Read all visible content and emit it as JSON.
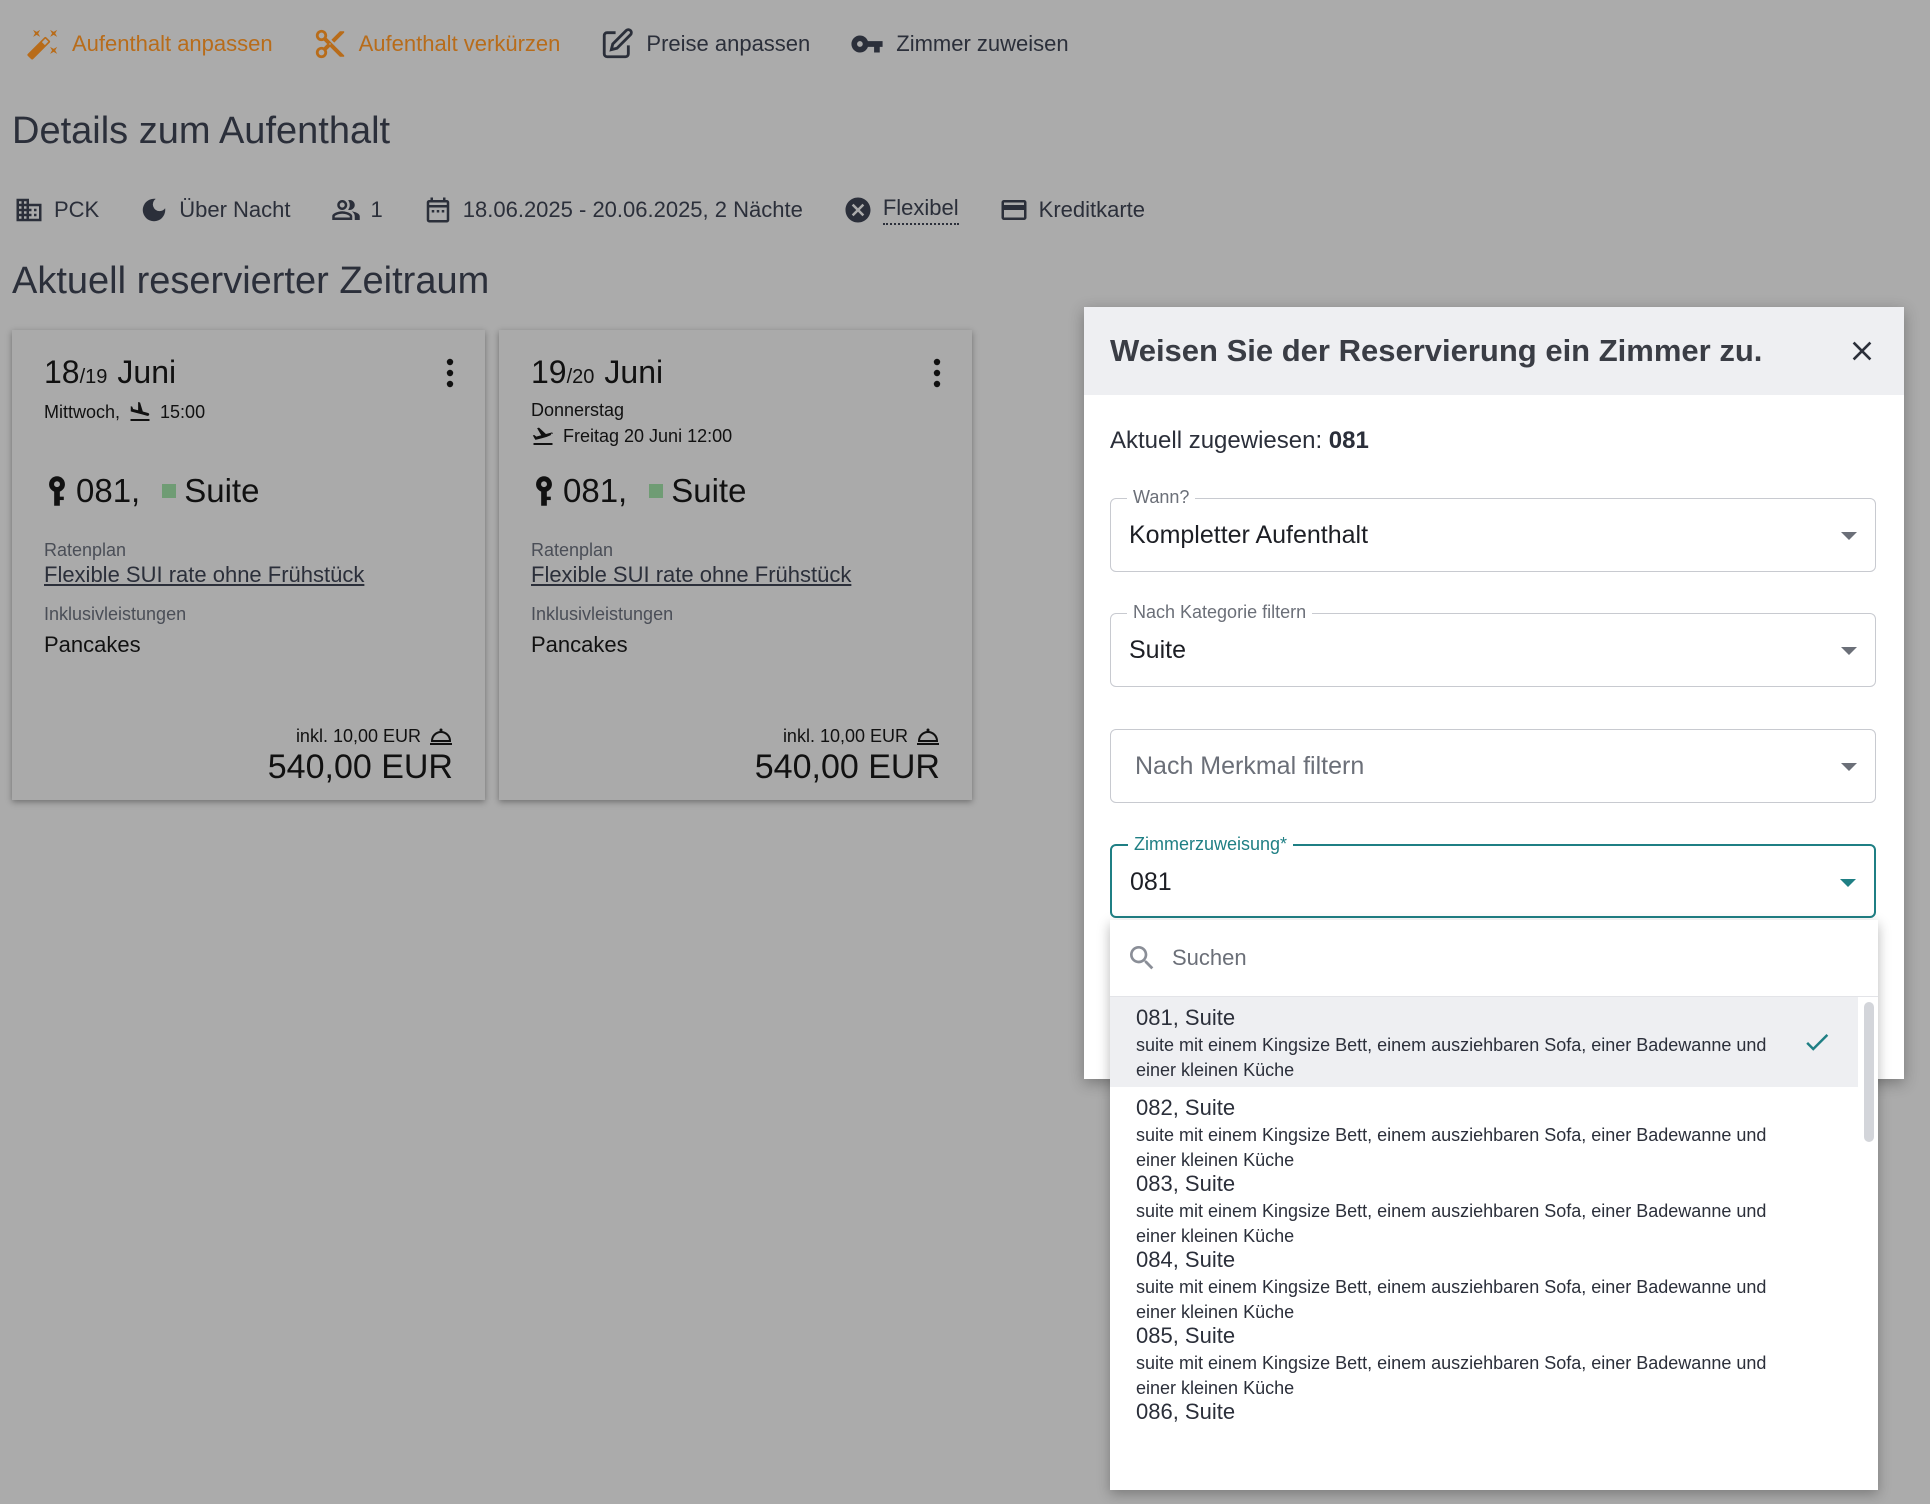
{
  "toolbar": {
    "adjust_stay": "Aufenthalt anpassen",
    "shorten_stay": "Aufenthalt verkürzen",
    "adjust_prices": "Preise anpassen",
    "assign_room": "Zimmer zuweisen"
  },
  "details": {
    "title": "Details zum Aufenthalt",
    "property": "PCK",
    "stay_type": "Über Nacht",
    "guests": "1",
    "dates": "18.06.2025 - 20.06.2025, 2 Nächte",
    "cancellation": "Flexibel",
    "payment": "Kreditkarte"
  },
  "period_title": "Aktuell reservierter Zeitraum",
  "days": [
    {
      "day": "18",
      "next": "/19",
      "month": "Juni",
      "weekday": "Mittwoch,",
      "arrival_time": "15:00",
      "room": "081,",
      "category": "Suite",
      "rate_label": "Ratenplan",
      "rate": "Flexible SUI rate ohne Frühstück",
      "incl_label": "Inklusivleistungen",
      "incl": "Pancakes",
      "fee": "inkl. 10,00 EUR",
      "price": "540,00 EUR"
    },
    {
      "day": "19",
      "next": "/20",
      "month": "Juni",
      "weekday": "Donnerstag",
      "departure": "Freitag  20 Juni 12:00",
      "room": "081,",
      "category": "Suite",
      "rate_label": "Ratenplan",
      "rate": "Flexible SUI rate ohne Frühstück",
      "incl_label": "Inklusivleistungen",
      "incl": "Pancakes",
      "fee": "inkl. 10,00 EUR",
      "price": "540,00 EUR"
    }
  ],
  "dialog": {
    "title": "Weisen Sie der Reservierung ein Zimmer zu.",
    "current_label": "Aktuell zugewiesen:",
    "current_value": "081",
    "when_label": "Wann?",
    "when_value": "Kompletter Aufenthalt",
    "category_label": "Nach Kategorie filtern",
    "category_value": "Suite",
    "feature_placeholder": "Nach Merkmal filtern",
    "room_label": "Zimmerzuweisung*",
    "room_value": "081"
  },
  "dropdown": {
    "search_placeholder": "Suchen",
    "options": [
      {
        "name": "081, Suite",
        "desc": "suite mit einem Kingsize Bett, einem ausziehbaren Sofa, einer Badewanne und einer kleinen Küche",
        "selected": true
      },
      {
        "name": "082, Suite",
        "desc": "suite mit einem Kingsize Bett, einem ausziehbaren Sofa, einer Badewanne und einer kleinen Küche"
      },
      {
        "name": "083, Suite",
        "desc": "suite mit einem Kingsize Bett, einem ausziehbaren Sofa, einer Badewanne und einer kleinen Küche"
      },
      {
        "name": "084, Suite",
        "desc": "suite mit einem Kingsize Bett, einem ausziehbaren Sofa, einer Badewanne und einer kleinen Küche"
      },
      {
        "name": "085, Suite",
        "desc": "suite mit einem Kingsize Bett, einem ausziehbaren Sofa, einer Badewanne und einer kleinen Küche"
      },
      {
        "name": "086, Suite",
        "desc": ""
      }
    ]
  },
  "colors": {
    "accent": "#1f7f84",
    "toolbar_orange": "#b86c1a",
    "overlay_bg": "#ababab",
    "category_marker": "#6f9c74"
  },
  "icons": [
    "magic-wand-icon",
    "scissors-icon",
    "edit-icon",
    "key-icon",
    "building-icon",
    "moon-icon",
    "people-icon",
    "calendar-icon",
    "cancel-circle-icon",
    "credit-card-icon",
    "kebab-menu-icon",
    "plane-landing-icon",
    "plane-takeoff-icon",
    "room-key-icon",
    "cloche-icon",
    "close-icon",
    "search-icon",
    "check-icon"
  ]
}
